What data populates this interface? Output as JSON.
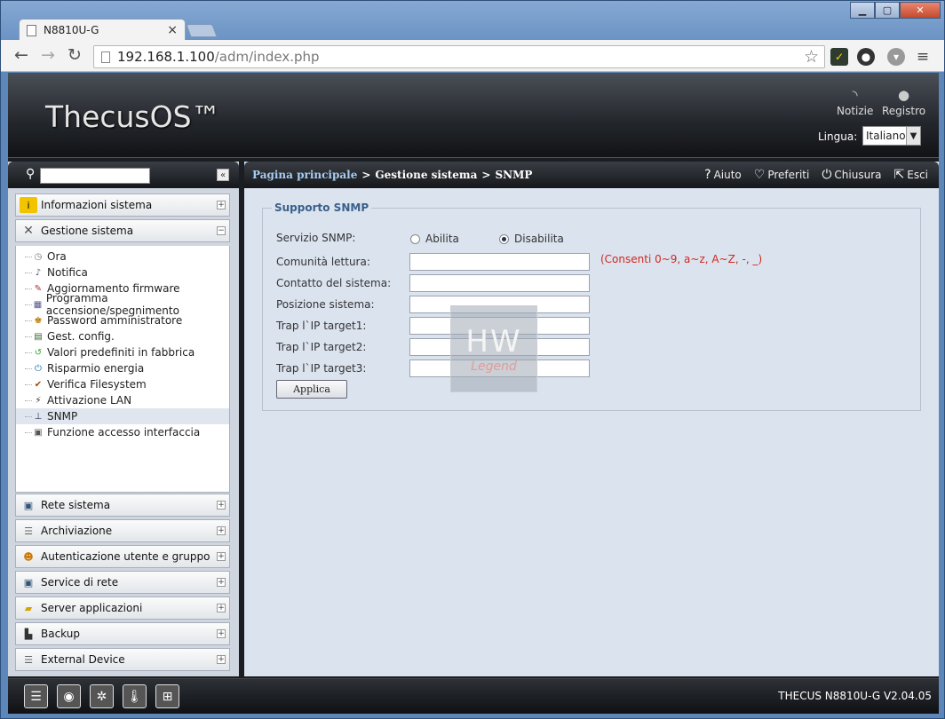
{
  "browser": {
    "tab_title": "N8810U-G",
    "url_host": "192.168.1.100",
    "url_path": "/adm/index.php"
  },
  "header": {
    "logo": "ThecusOS™",
    "news_label": "Notizie",
    "log_label": "Registro",
    "language_label": "Lingua:",
    "language_value": "Italiano"
  },
  "sidebar": {
    "categories": {
      "info": "Informazioni sistema",
      "system": "Gestione sistema",
      "network": "Rete sistema",
      "storage": "Archiviazione",
      "auth": "Autenticazione utente e gruppo",
      "netservice": "Service di rete",
      "appserver": "Server applicazioni",
      "backup": "Backup",
      "external": "External Device"
    },
    "items": [
      "Ora",
      "Notifica",
      "Aggiornamento firmware",
      "Programma accensione/spegnimento",
      "Password amministratore",
      "Gest. config.",
      "Valori predefiniti in fabbrica",
      "Risparmio energia",
      "Verifica Filesystem",
      "Attivazione LAN",
      "SNMP",
      "Funzione accesso interfaccia"
    ]
  },
  "breadcrumb": {
    "home": "Pagina principale",
    "section": "Gestione sistema",
    "page": "SNMP"
  },
  "actions": {
    "help": "Aiuto",
    "favorites": "Preferiti",
    "shutdown": "Chiusura",
    "logout": "Esci"
  },
  "form": {
    "legend": "Supporto SNMP",
    "service_label": "Servizio SNMP:",
    "enable_label": "Abilita",
    "disable_label": "Disabilita",
    "community_label": "Comunità lettura:",
    "community_hint": "(Consenti 0~9, a~z, A~Z, -, _)",
    "contact_label": "Contatto del sistema:",
    "location_label": "Posizione sistema:",
    "trap1_label": "Trap l`IP target1:",
    "trap2_label": "Trap l`IP target2:",
    "trap3_label": "Trap l`IP target3:",
    "apply_label": "Applica"
  },
  "watermark": {
    "mark": "HW",
    "text": "Legend"
  },
  "footer": {
    "version": "THECUS N8810U-G V2.04.05"
  }
}
